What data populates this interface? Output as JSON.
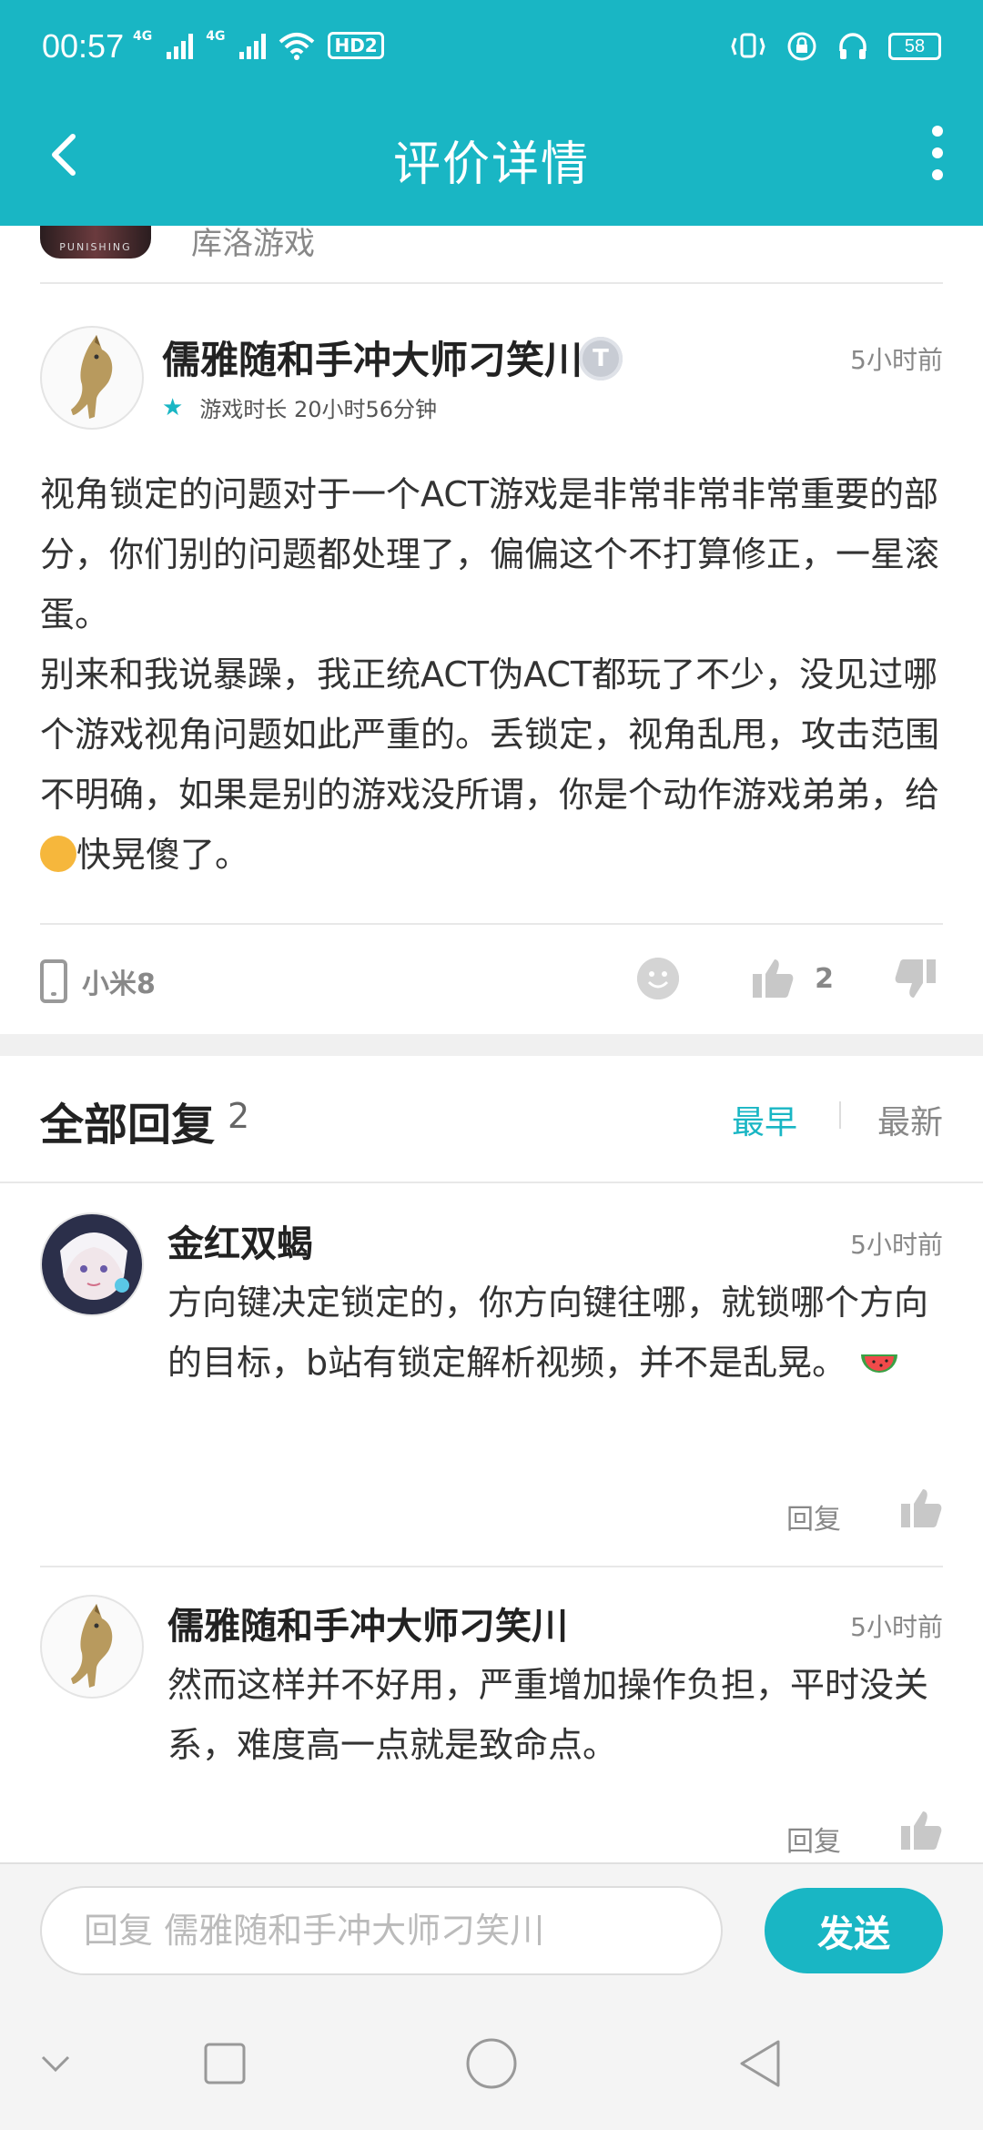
{
  "status_bar": {
    "time": "00:57",
    "network1": "4G",
    "network2": "4G",
    "hd": "HD2",
    "battery": "58"
  },
  "header": {
    "title": "评价详情"
  },
  "game": {
    "thumb_text": "PUNISHING",
    "name": "库洛游戏"
  },
  "review": {
    "user": "儒雅随和手冲大师刁笑川",
    "badge": "T",
    "time": "5小时前",
    "playtime": "游戏时长 20小时56分钟",
    "text_a": "视角锁定的问题对于一个ACT游戏是非常非常非常重要的部分，你们别的问题都处理了，偏偏这个不打算修正，一星滚蛋。\n别来和我说暴躁，我正统ACT伪ACT都玩了不少，没见过哪个游戏视角问题如此严重的。丢锁定，视角乱甩，攻击范围不明确，如果是别的游戏没所谓，你是个动作游戏弟弟，给",
    "text_b": "快晃傻了。",
    "device": "小米8",
    "likes": "2"
  },
  "replies": {
    "heading": "全部回复",
    "count": "2",
    "sort_early": "最早",
    "sort_new": "最新",
    "items": [
      {
        "name": "金红双蝎",
        "time": "5小时前",
        "text": "方向键决定锁定的，你方向键往哪，就锁哪个方向的目标，b站有锁定解析视频，并不是乱晃。",
        "reply_label": "回复"
      },
      {
        "name": "儒雅随和手冲大师刁笑川",
        "time": "5小时前",
        "text": "然而这样并不好用，严重增加操作负担，平时没关系，难度高一点就是致命点。",
        "reply_label": "回复"
      }
    ]
  },
  "compose": {
    "placeholder": "回复 儒雅随和手冲大师刁笑川",
    "send_label": "发送"
  },
  "colors": {
    "accent": "#19b6c4"
  }
}
